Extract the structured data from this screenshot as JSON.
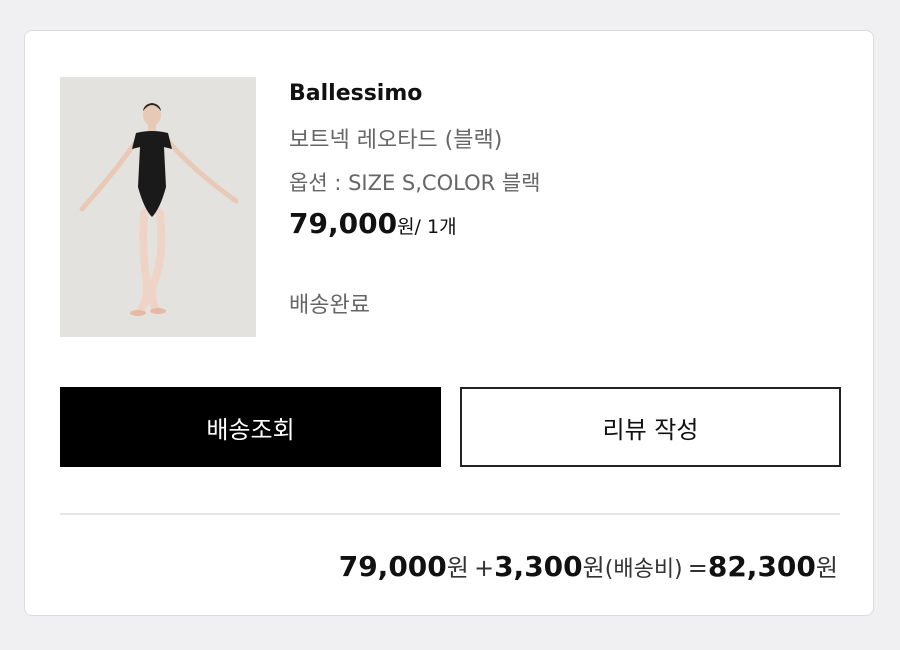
{
  "product": {
    "brand": "Ballessimo",
    "name": "보트넥 레오타드 (블랙)",
    "option": "옵션 : SIZE S,COLOR 블랙",
    "price": "79,000",
    "price_currency": "원",
    "quantity_text": "/ 1개",
    "status": "배송완료",
    "image_icon": "leotard-photo"
  },
  "actions": {
    "track_delivery_label": "배송조회",
    "write_review_label": "리뷰 작성"
  },
  "summary": {
    "item_price": "79,000",
    "item_currency": "원",
    "plus": "+",
    "shipping_price": "3,300",
    "shipping_currency": "원",
    "shipping_note": "(배송비)",
    "equals": "=",
    "total_price": "82,300",
    "total_currency": "원"
  },
  "colors": {
    "primary_button": "#000000",
    "text_muted": "#666666",
    "border": "#dcdcdc"
  }
}
